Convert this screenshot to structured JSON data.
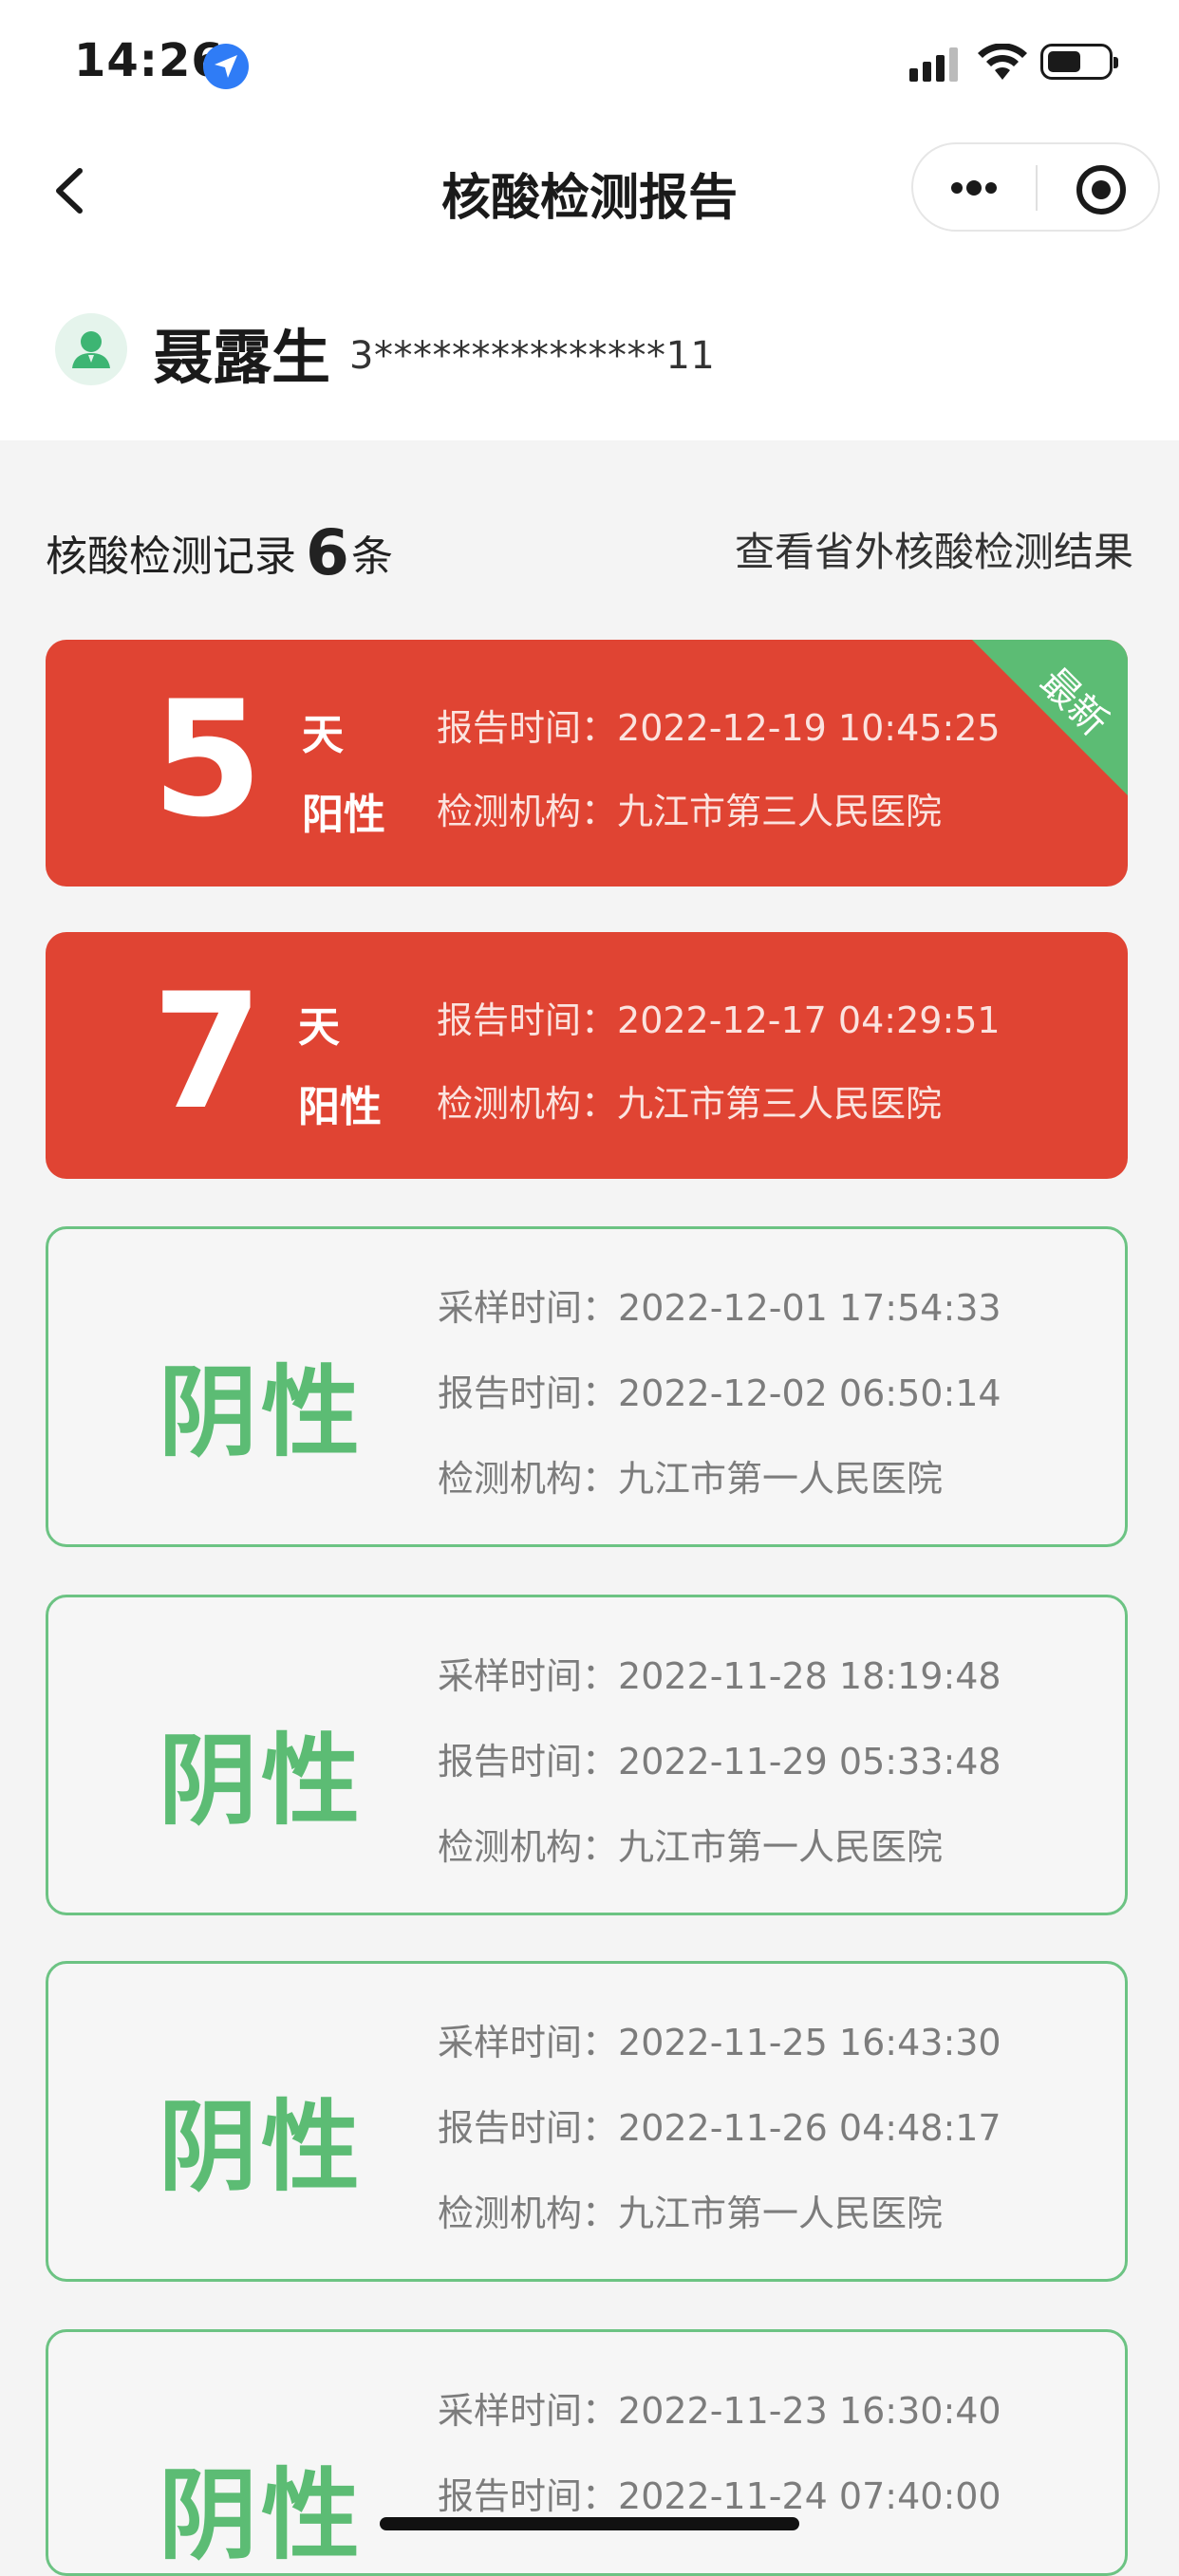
{
  "status_bar": {
    "time": "14:26"
  },
  "nav": {
    "title": "核酸检测报告"
  },
  "user": {
    "name": "聂露生",
    "id_masked": "3***************11"
  },
  "records_header": {
    "prefix": "核酸检测记录",
    "count": "6",
    "suffix": "条",
    "outside_link": "查看省外核酸检测结果"
  },
  "labels": {
    "sample_time": "采样时间：",
    "report_time": "报告时间：",
    "institution": "检测机构：",
    "day_unit": "天",
    "positive": "阳性",
    "negative": "阴性",
    "newest": "最新"
  },
  "positive_records": [
    {
      "days": "5",
      "report_time": "2022-12-19 10:45:25",
      "institution": "九江市第三人民医院",
      "newest": true
    },
    {
      "days": "7",
      "report_time": "2022-12-17 04:29:51",
      "institution": "九江市第三人民医院",
      "newest": false
    }
  ],
  "negative_records": [
    {
      "sample_time": "2022-12-01 17:54:33",
      "report_time": "2022-12-02 06:50:14",
      "institution": "九江市第一人民医院"
    },
    {
      "sample_time": "2022-11-28 18:19:48",
      "report_time": "2022-11-29 05:33:48",
      "institution": "九江市第一人民医院"
    },
    {
      "sample_time": "2022-11-25 16:43:30",
      "report_time": "2022-11-26 04:48:17",
      "institution": "九江市第一人民医院"
    },
    {
      "sample_time": "2022-11-23 16:30:40",
      "report_time": "2022-11-24 07:40:00",
      "institution": ""
    }
  ],
  "colors": {
    "positive": "#e04433",
    "negative": "#5cbc74",
    "newest_ribbon": "#5cbc74"
  }
}
